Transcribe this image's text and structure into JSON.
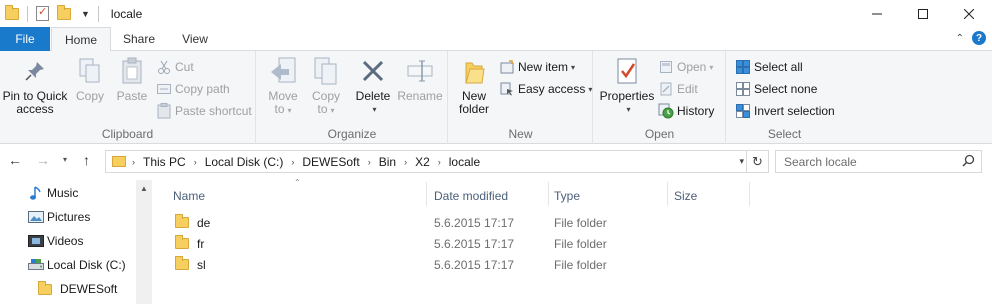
{
  "window": {
    "title": "locale",
    "controls": [
      "minimize",
      "maximize",
      "close"
    ]
  },
  "tabs": {
    "file": "File",
    "home": "Home",
    "share": "Share",
    "view": "View"
  },
  "ribbon": {
    "clipboard": {
      "label": "Clipboard",
      "pin_line1": "Pin to Quick",
      "pin_line2": "access",
      "copy": "Copy",
      "paste": "Paste",
      "cut": "Cut",
      "copy_path": "Copy path",
      "paste_shortcut": "Paste shortcut"
    },
    "organize": {
      "label": "Organize",
      "move_line1": "Move",
      "move_line2": "to",
      "copy_line1": "Copy",
      "copy_line2": "to",
      "delete": "Delete",
      "rename": "Rename"
    },
    "new": {
      "label": "New",
      "new_folder_line1": "New",
      "new_folder_line2": "folder",
      "new_item": "New item",
      "easy_access": "Easy access"
    },
    "open": {
      "label": "Open",
      "properties": "Properties",
      "open": "Open",
      "edit": "Edit",
      "history": "History"
    },
    "select": {
      "label": "Select",
      "select_all": "Select all",
      "select_none": "Select none",
      "invert_selection": "Invert selection"
    }
  },
  "address": {
    "crumbs": [
      "This PC",
      "Local Disk (C:)",
      "DEWESoft",
      "Bin",
      "X2",
      "locale"
    ],
    "search_placeholder": "Search locale"
  },
  "nav_pane": {
    "items": [
      "Music",
      "Pictures",
      "Videos",
      "Local Disk (C:)",
      "DEWESoft"
    ]
  },
  "columns": {
    "name": "Name",
    "date": "Date modified",
    "type": "Type",
    "size": "Size"
  },
  "files": [
    {
      "name": "de",
      "date": "5.6.2015 17:17",
      "type": "File folder",
      "size": ""
    },
    {
      "name": "fr",
      "date": "5.6.2015 17:17",
      "type": "File folder",
      "size": ""
    },
    {
      "name": "sl",
      "date": "5.6.2015 17:17",
      "type": "File folder",
      "size": ""
    }
  ],
  "colors": {
    "accent": "#1979ca",
    "folder": "#f6cf5f",
    "ribbon_bg": "#f5f6f7",
    "header_text": "#4c607a"
  }
}
